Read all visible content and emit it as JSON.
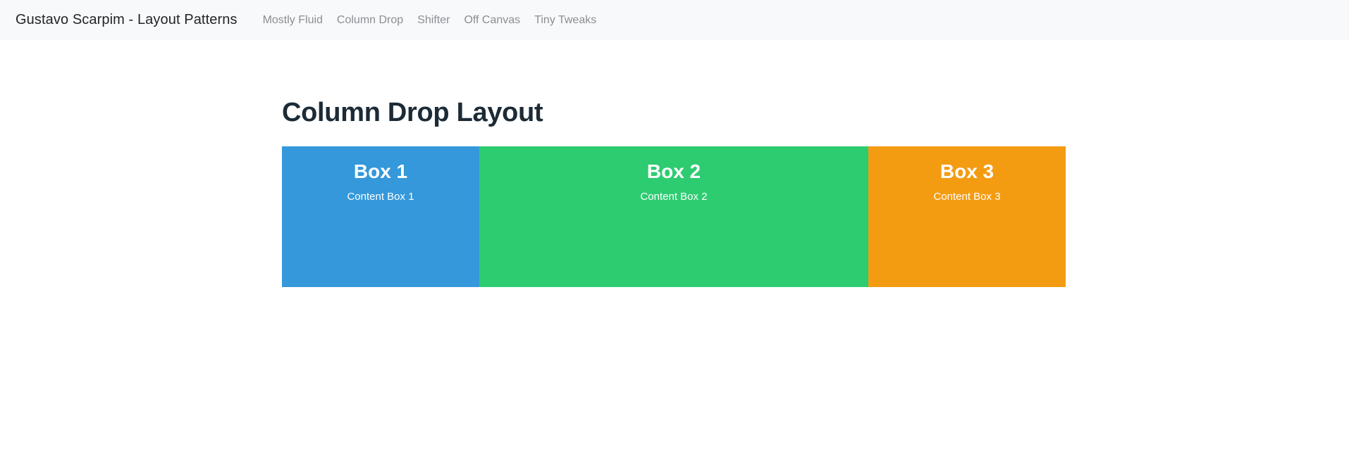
{
  "navbar": {
    "brand": "Gustavo Scarpim - Layout Patterns",
    "background_color": "#f8f9fa",
    "brand_color": "#212529",
    "link_color": "#8a8f94",
    "links": [
      {
        "label": "Mostly Fluid"
      },
      {
        "label": "Column Drop"
      },
      {
        "label": "Shifter"
      },
      {
        "label": "Off Canvas"
      },
      {
        "label": "Tiny Tweaks"
      }
    ]
  },
  "main": {
    "title": "Column Drop Layout",
    "title_color": "#1c2b36",
    "boxes": [
      {
        "title": "Box 1",
        "text": "Content Box 1",
        "color": "#3498db"
      },
      {
        "title": "Box 2",
        "text": "Content Box 2",
        "color": "#2ecc71"
      },
      {
        "title": "Box 3",
        "text": "Content Box 3",
        "color": "#f39c12"
      }
    ]
  }
}
